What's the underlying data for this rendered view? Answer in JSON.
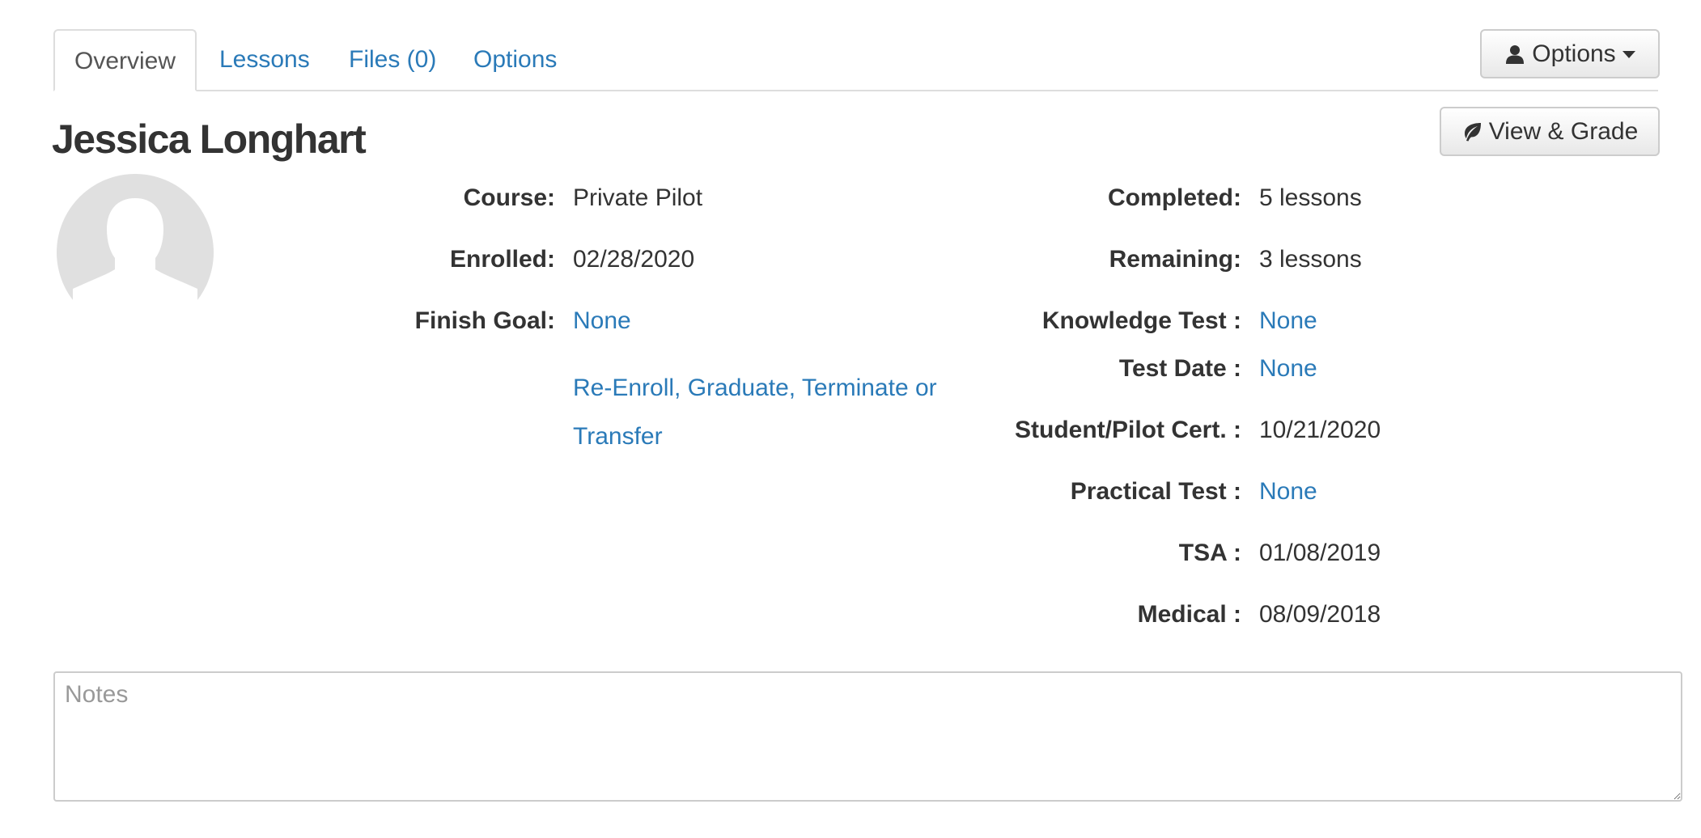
{
  "tabs": {
    "overview": "Overview",
    "lessons": "Lessons",
    "files": "Files (0)",
    "options": "Options"
  },
  "buttons": {
    "options_label": "Options",
    "view_grade_label": "View & Grade"
  },
  "icons": {
    "options_icon": "user-icon",
    "view_grade_icon": "leaf-icon",
    "avatar_icon": "default-avatar"
  },
  "student": {
    "name": "Jessica Longhart"
  },
  "details_left": {
    "course_label": "Course:",
    "course_value": "Private Pilot",
    "enrolled_label": "Enrolled:",
    "enrolled_value": "02/28/2020",
    "finish_goal_label": "Finish Goal:",
    "finish_goal_value": "None",
    "actions_link": "Re-Enroll, Graduate, Terminate or Transfer"
  },
  "details_right": {
    "completed_label": "Completed:",
    "completed_value": "5 lessons",
    "remaining_label": "Remaining:",
    "remaining_value": "3 lessons",
    "knowledge_test_label": "Knowledge Test :",
    "knowledge_test_value": "None",
    "test_date_label": "Test Date :",
    "test_date_value": "None",
    "cert_label": "Student/Pilot Cert. :",
    "cert_value": "10/21/2020",
    "practical_test_label": "Practical Test :",
    "practical_test_value": "None",
    "tsa_label": "TSA :",
    "tsa_value": "01/08/2019",
    "medical_label": "Medical :",
    "medical_value": "08/09/2018"
  },
  "notes": {
    "value": "",
    "placeholder": "Notes"
  },
  "colors": {
    "link": "#2a7ab8",
    "text": "#333333",
    "border": "#dddddd",
    "avatar": "#e0e0e0"
  }
}
